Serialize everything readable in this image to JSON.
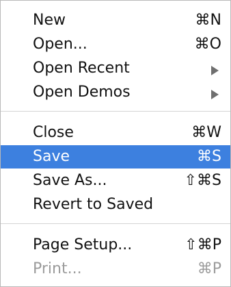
{
  "menu": {
    "items": [
      {
        "label": "New",
        "shortcut": "⌘N"
      },
      {
        "label": "Open...",
        "shortcut": "⌘O"
      },
      {
        "label": "Open Recent",
        "shortcut": "",
        "submenu_icon": "submenu-arrow-icon"
      },
      {
        "label": "Open Demos",
        "shortcut": "",
        "submenu_icon": "submenu-arrow-icon"
      },
      {
        "label": "Close",
        "shortcut": "⌘W"
      },
      {
        "label": "Save",
        "shortcut": "⌘S",
        "state": "selected"
      },
      {
        "label": "Save As...",
        "shortcut": "⇧⌘S"
      },
      {
        "label": "Revert to Saved",
        "shortcut": ""
      },
      {
        "label": "Page Setup...",
        "shortcut": "⇧⌘P"
      },
      {
        "label": "Print...",
        "shortcut": "⌘P",
        "state": "disabled"
      }
    ]
  },
  "colors": {
    "selection": "#3d80df",
    "disabled_text": "#9b9b9b",
    "text": "#111111"
  }
}
